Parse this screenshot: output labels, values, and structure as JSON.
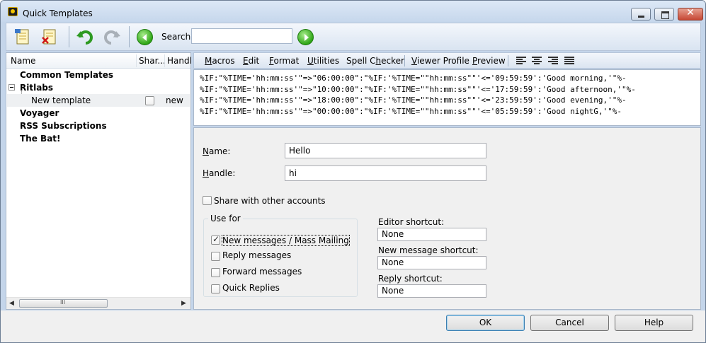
{
  "window": {
    "title": "Quick Templates",
    "close_glyph": "✕"
  },
  "toolbar": {
    "search_label": "Search",
    "search_value": "",
    "icons": [
      "new-template-icon",
      "delete-template-icon",
      "undo-icon",
      "redo-icon",
      "search-back-icon",
      "search-go-icon"
    ]
  },
  "tree": {
    "columns": [
      "Name",
      "Shar...",
      "Handl"
    ],
    "items": [
      {
        "label": "Common Templates",
        "bold": true
      },
      {
        "label": "Ritlabs",
        "bold": true,
        "expanded": true
      },
      {
        "label": "New template",
        "bold": false,
        "shared": false,
        "handle": "new"
      },
      {
        "label": "Voyager",
        "bold": true
      },
      {
        "label": "RSS Subscriptions",
        "bold": true
      },
      {
        "label": "The Bat!",
        "bold": true
      }
    ],
    "scroll_grip": "III"
  },
  "menu": {
    "items": [
      "Macros",
      "Edit",
      "Format",
      "Utilities",
      "Spell Checker",
      "Viewer Profile",
      "Preview"
    ],
    "align_icons": [
      "align-left-icon",
      "align-center-icon",
      "align-right-icon",
      "align-justify-icon"
    ]
  },
  "editor": {
    "lines": [
      "%IF:\"%TIME='hh:mm:ss'\"=>\"06:00:00\":\"%IF:'%TIME=\"\"hh:mm:ss\"\"'<='09:59:59':'Good morning,'\"%-",
      "%IF:\"%TIME='hh:mm:ss'\"=>\"10:00:00\":\"%IF:'%TIME=\"\"hh:mm:ss\"\"'<='17:59:59':'Good afternoon,'\"%-",
      "%IF:\"%TIME='hh:mm:ss'\"=>\"18:00:00\":\"%IF:'%TIME=\"\"hh:mm:ss\"\"'<='23:59:59':'Good evening,'\"%-",
      "%IF:\"%TIME='hh:mm:ss'\"=>\"00:00:00\":\"%IF:'%TIME=\"\"hh:mm:ss\"\"'<='05:59:59':'Good nightG,'\"%-"
    ]
  },
  "props": {
    "name_label": "Name:",
    "name_value": "Hello",
    "handle_label": "Handle:",
    "handle_value": "hi",
    "share_label": "Share with other accounts",
    "share_checked": false,
    "use_for_label": "Use for",
    "use_for": [
      {
        "label": "New messages / Mass Mailing",
        "checked": true
      },
      {
        "label": "Reply messages",
        "checked": false
      },
      {
        "label": "Forward messages",
        "checked": false
      },
      {
        "label": "Quick Replies",
        "checked": false
      }
    ],
    "editor_shortcut_label": "Editor shortcut:",
    "editor_shortcut_value": "None",
    "new_message_shortcut_label": "New message shortcut:",
    "new_message_shortcut_value": "None",
    "reply_shortcut_label": "Reply shortcut:",
    "reply_shortcut_value": "None"
  },
  "buttons": {
    "ok": "OK",
    "cancel": "Cancel",
    "help": "Help"
  },
  "colors": {
    "accent_green": "#2fa617",
    "title_bg": "#c4d5ea",
    "close_red": "#c64734"
  }
}
